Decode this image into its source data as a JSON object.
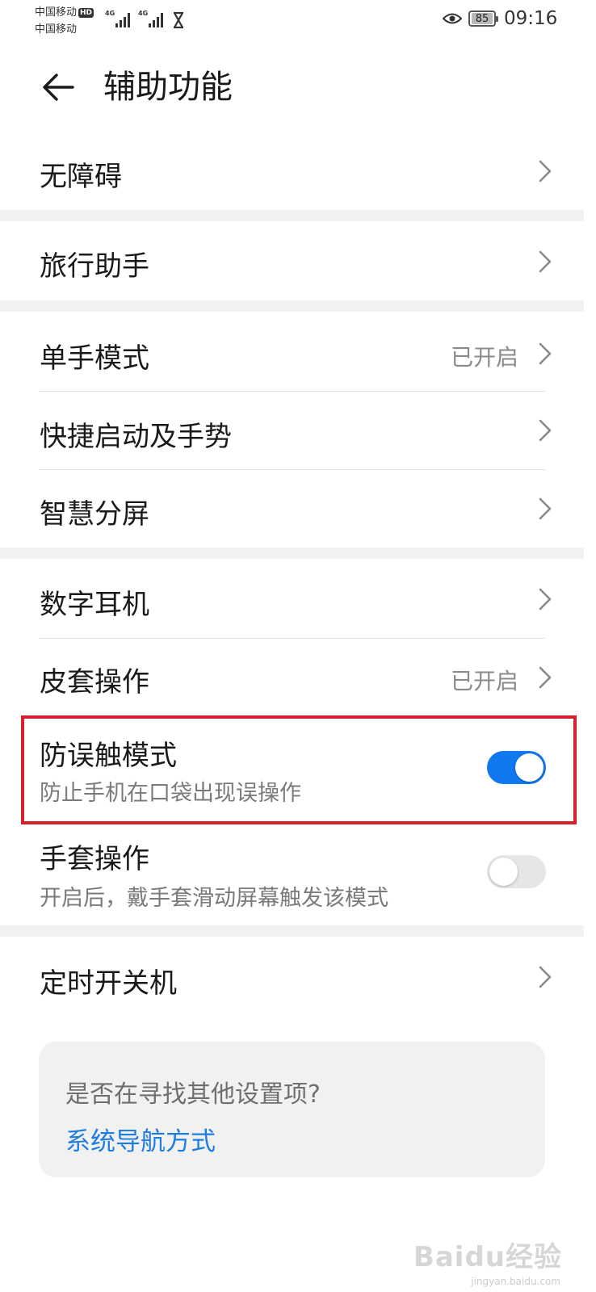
{
  "status_bar": {
    "carrier1": "中国移动",
    "carrier1_badge": "HD",
    "carrier2": "中国移动",
    "network1": "4G",
    "network2": "4G",
    "battery": "85",
    "time": "09:16"
  },
  "header": {
    "title": "辅助功能"
  },
  "rows": {
    "accessibility": {
      "label": "无障碍"
    },
    "travel_assistant": {
      "label": "旅行助手"
    },
    "one_hand_mode": {
      "label": "单手模式",
      "value": "已开启"
    },
    "shortcuts_gestures": {
      "label": "快捷启动及手势"
    },
    "smart_split": {
      "label": "智慧分屏"
    },
    "digital_earphone": {
      "label": "数字耳机"
    },
    "cover_operation": {
      "label": "皮套操作",
      "value": "已开启"
    },
    "accidental_touch": {
      "label": "防误触模式",
      "subtitle": "防止手机在口袋出现误操作",
      "enabled": true
    },
    "glove_mode": {
      "label": "手套操作",
      "subtitle": "开启后，戴手套滑动屏幕触发该模式",
      "enabled": false
    },
    "scheduled_power": {
      "label": "定时开关机"
    }
  },
  "suggestion_card": {
    "question": "是否在寻找其他设置项?",
    "link": "系统导航方式"
  },
  "watermark": {
    "brand": "Baidu经验",
    "url": "jingyan.baidu.com"
  },
  "colors": {
    "accent": "#1178f0",
    "highlight_border": "#d5202e",
    "link": "#1f7de1"
  }
}
